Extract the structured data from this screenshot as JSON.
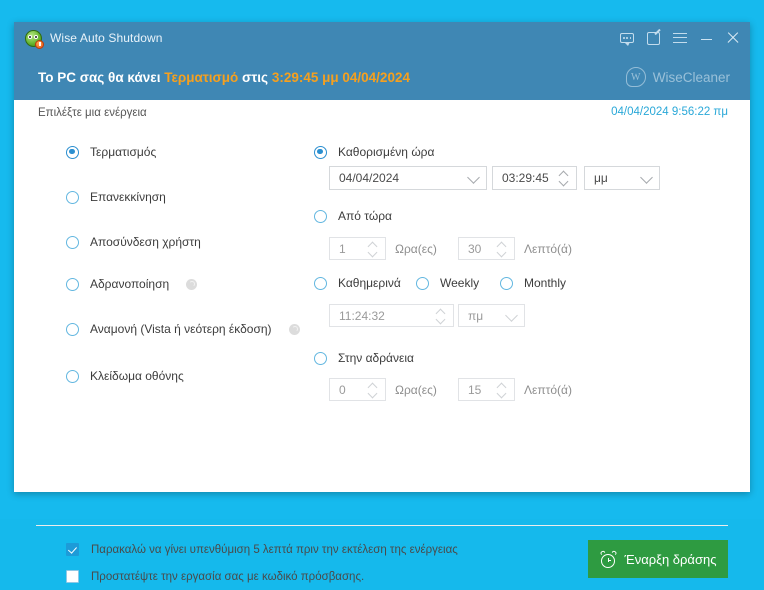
{
  "window": {
    "title": "Wise Auto Shutdown",
    "logo_icon": "wise-auto-shutdown-logo-icon",
    "titlebar_icons": [
      {
        "name": "feedback-icon",
        "label": "Feedback"
      },
      {
        "name": "edit-icon",
        "label": "Edit"
      },
      {
        "name": "menu-icon",
        "label": "Menu"
      },
      {
        "name": "minimize-icon",
        "label": "Minimize"
      },
      {
        "name": "close-icon",
        "label": "Close"
      }
    ]
  },
  "banner": {
    "prefix": "Το PC σας θα κάνει ",
    "action": "Τερματισμό",
    "middle": " στις ",
    "datetime": "3:29:45 μμ 04/04/2024",
    "brand": "WiseCleaner",
    "brand_mark": "W",
    "accent_color": "#f6a01e",
    "bar_color": "#3f87b4"
  },
  "subheader": {
    "label": "Επιλέξτε μια ενέργεια",
    "clock": "04/04/2024 9:56:22 πμ",
    "clock_color": "#2aa8d8"
  },
  "actions": [
    {
      "label": "Τερματισμός",
      "selected": true,
      "help": false
    },
    {
      "label": "Επανεκκίνηση",
      "selected": false,
      "help": false
    },
    {
      "label": "Αποσύνδεση χρήστη",
      "selected": false,
      "help": false
    },
    {
      "label": "Αδρανοποίηση",
      "selected": false,
      "help": true
    },
    {
      "label": "Αναμονή (Vista ή νεότερη έκδοση)",
      "selected": false,
      "help": true
    },
    {
      "label": "Κλείδωμα οθόνης",
      "selected": false,
      "help": false
    }
  ],
  "schedule": {
    "specific_time": {
      "label": "Καθορισμένη ώρα",
      "selected": true,
      "date": "04/04/2024",
      "time": "03:29:45",
      "meridiem": "μμ"
    },
    "from_now": {
      "label": "Από τώρα",
      "selected": false,
      "hours": "1",
      "hours_unit": "Ωρα(ες)",
      "minutes": "30",
      "minutes_unit": "Λεπτό(ά)"
    },
    "recurring": {
      "daily_label": "Καθημερινά",
      "weekly_label": "Weekly",
      "monthly_label": "Monthly",
      "daily_selected": false,
      "weekly_selected": false,
      "monthly_selected": false,
      "time": "11:24:32",
      "meridiem": "πμ"
    },
    "on_idle": {
      "label": "Στην αδράνεια",
      "selected": false,
      "hours": "0",
      "hours_unit": "Ωρα(ες)",
      "minutes": "15",
      "minutes_unit": "Λεπτό(ά)"
    }
  },
  "footer": {
    "remind": {
      "label": "Παρακαλώ να γίνει υπενθύμιση 5 λεπτά πριν την εκτέλεση της ενέργειας",
      "checked": true
    },
    "password": {
      "label": "Προστατέψτε την εργασία σας με κωδικό πρόσβασης.",
      "checked": false
    },
    "start_button": {
      "label": "Έναρξη δράσης",
      "icon": "alarm-clock-icon",
      "color": "#2e9b41"
    }
  }
}
